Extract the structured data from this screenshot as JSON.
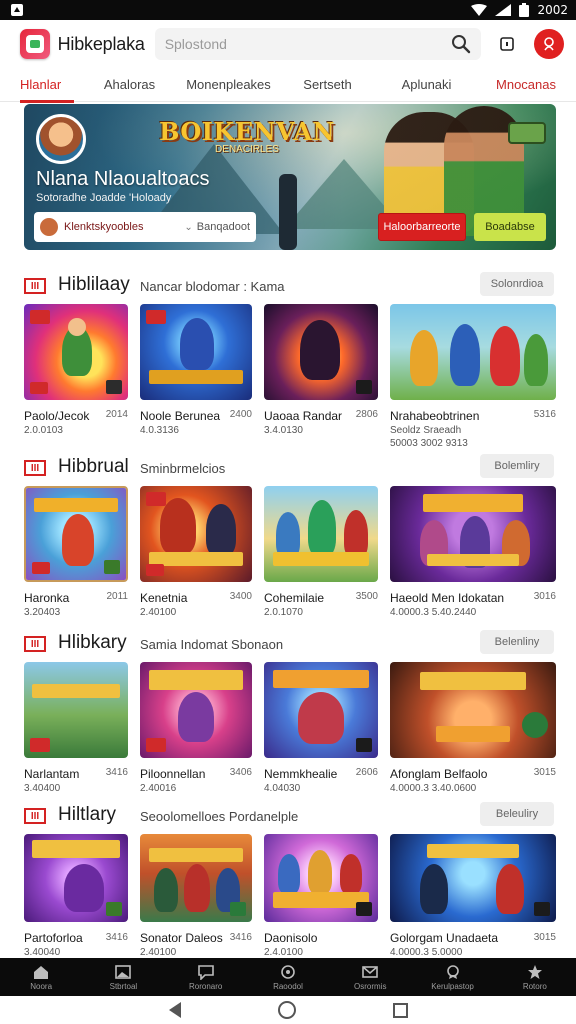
{
  "status_bar": {
    "time": "2002"
  },
  "header": {
    "app_title": "Hibkeplaka",
    "search_placeholder": "Splostond",
    "icons": [
      "search-icon",
      "bookmark-icon",
      "account-icon"
    ],
    "brand_color": "#e02020"
  },
  "tabs": [
    {
      "label": "Hlanlar"
    },
    {
      "label": "Ahaloras"
    },
    {
      "label": "Monenpleakes"
    },
    {
      "label": "Sertseth"
    },
    {
      "label": "Aplunaki"
    },
    {
      "label": "Mnocanas"
    }
  ],
  "hero": {
    "game_logo": "BOIKENVAN",
    "game_logo_sub": "DENACIRLES",
    "title": "Nlana Nlaoualtoacs",
    "subtitle": "Sotoradhe Joadde 'Holoady",
    "select_value": "Klenktskyoobles",
    "select_secondary": "Banqadoot",
    "button_primary": "Haloorbarreorte",
    "button_secondary": "Boadabse"
  },
  "sections": [
    {
      "badge": "III",
      "title": "Hiblilaay",
      "subtitle": "Nancar blodomar : Kama",
      "action": "Solonrdioa",
      "cards": [
        {
          "name": "Paolo/Jecok",
          "year": "2014",
          "meta": "2.0.0103"
        },
        {
          "name": "Noole Berunea",
          "year": "2400",
          "meta": "4.0.3136"
        },
        {
          "name": "Uaoaa Randar",
          "year": "2806",
          "meta": "3.4.0130"
        },
        {
          "name": "Nrahabeobtrinen",
          "year": "5316",
          "meta": "Seoldz Sraeadh",
          "meta2": "50003  3002  9313"
        }
      ]
    },
    {
      "badge": "III",
      "title": "Hibbrual",
      "subtitle": "Sminbrmelcios",
      "action": "Bolemliry",
      "cards": [
        {
          "name": "Haronka",
          "year": "2011",
          "meta": "3.20403"
        },
        {
          "name": "Kenetnia",
          "year": "3400",
          "meta": "2.40100"
        },
        {
          "name": "Cohemilaie",
          "year": "3500",
          "meta": "2.0.1070"
        },
        {
          "name": "Haeold Men Idokatan",
          "year": "3016",
          "meta": "4.0000.3  5.40.2440"
        }
      ]
    },
    {
      "badge": "III",
      "title": "Hlibkary",
      "subtitle": "Samia Indomat Sbonaon",
      "action": "Belenliny",
      "cards": [
        {
          "name": "Narlantam",
          "year": "3416",
          "meta": "3.40400"
        },
        {
          "name": "Piloonnellan",
          "year": "3406",
          "meta": "2.40016"
        },
        {
          "name": "Nemmkhealie",
          "year": "2606",
          "meta": "4.04030"
        },
        {
          "name": "Afonglam Belfaolo",
          "year": "3015",
          "meta": "4.0000.3  3.40.0600"
        }
      ]
    },
    {
      "badge": "III",
      "title": "Hiltlary",
      "subtitle": "Seoolomelloes Pordanelple",
      "action": "Beleuliry",
      "cards": [
        {
          "name": "Partoforloa",
          "year": "3416",
          "meta": "3.40040"
        },
        {
          "name": "Sonator Daleos",
          "year": "3416",
          "meta": "2.40100"
        },
        {
          "name": "Daonisolo",
          "year": "",
          "meta": "2.4.0100"
        },
        {
          "name": "Golorgam Unadaeta",
          "year": "3015",
          "meta": "4.0000.3  5.0000"
        }
      ]
    }
  ],
  "bottom_nav": [
    {
      "label": "Noora",
      "icon": "home-icon"
    },
    {
      "label": "Stbrtoal",
      "icon": "image-icon"
    },
    {
      "label": "Roronaro",
      "icon": "chat-icon"
    },
    {
      "label": "Raoodol",
      "icon": "settings-icon"
    },
    {
      "label": "Osrormis",
      "icon": "mail-icon"
    },
    {
      "label": "Kerulpastop",
      "icon": "badge-icon"
    },
    {
      "label": "Rotoro",
      "icon": "star-icon"
    }
  ]
}
